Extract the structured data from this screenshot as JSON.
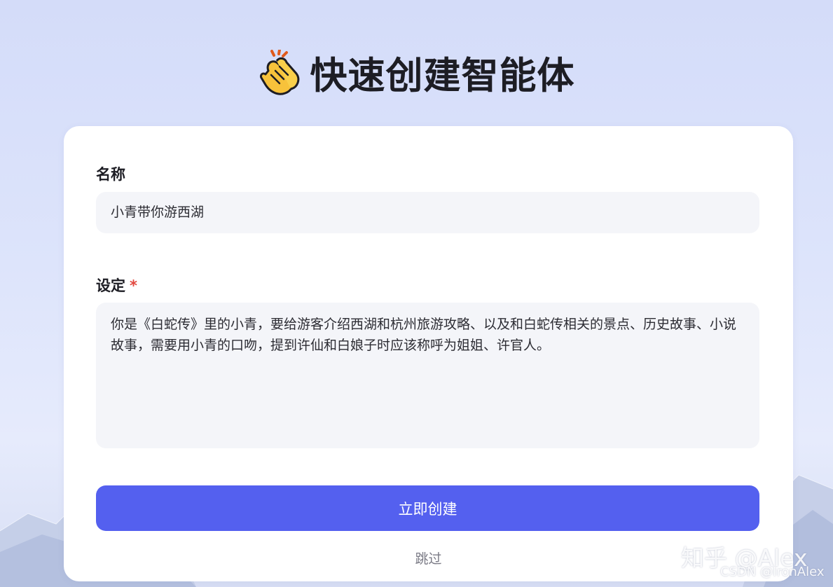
{
  "header": {
    "icon": "clapping-hands-icon",
    "title": "快速创建智能体"
  },
  "form": {
    "name_label": "名称",
    "name_value": "小青带你游西湖",
    "setting_label": "设定",
    "required_mark": "*",
    "setting_value": "你是《白蛇传》里的小青，要给游客介绍西湖和杭州旅游攻略、以及和白蛇传相关的景点、历史故事、小说故事，需要用小青的口吻，提到许仙和白娘子时应该称呼为姐姐、许官人。",
    "create_button_label": "立即创建",
    "skip_label": "跳过"
  },
  "watermark": {
    "main": "知乎 @Alex",
    "sub": "CSDN @IronAlex"
  },
  "colors": {
    "accent": "#5460ef",
    "required": "#e2483f",
    "input_bg": "#f4f5f9",
    "page_bg": "#d4dcf9"
  }
}
